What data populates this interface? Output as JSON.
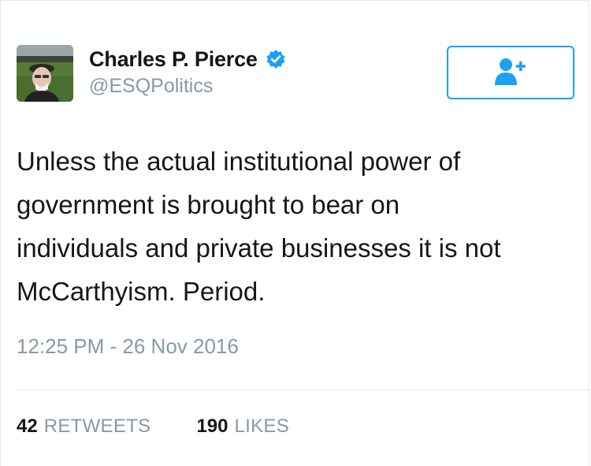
{
  "tweet": {
    "author": {
      "display_name": "Charles P. Pierce",
      "handle": "@ESQPolitics",
      "verified": true,
      "avatar_icon": "profile-photo"
    },
    "follow_button": {
      "icon": "add-user-icon",
      "accent_color": "#1da1f2"
    },
    "text_lines": [
      "Unless the actual institutional power of",
      "government is brought to bear on",
      "individuals and private businesses it is not",
      "McCarthyism. Period."
    ],
    "timestamp": "12:25 PM - 26 Nov 2016",
    "stats": {
      "retweets_count": "42",
      "retweets_label": "RETWEETS",
      "likes_count": "190",
      "likes_label": "LIKES"
    }
  },
  "colors": {
    "text_primary": "#14171a",
    "text_secondary": "#8899a6",
    "accent": "#1da1f2",
    "divider": "#e1e8ed"
  }
}
